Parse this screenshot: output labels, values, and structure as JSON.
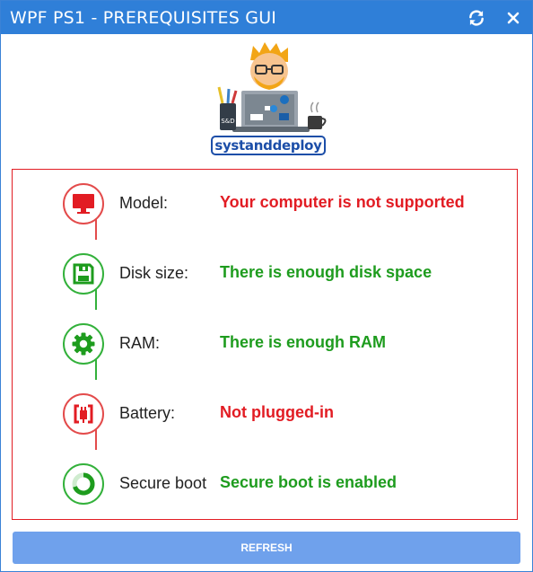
{
  "window": {
    "title": "WPF PS1 - PREREQUISITES GUI",
    "titlebar_color": "#2f7fd8"
  },
  "logo": {
    "text": "systanddeploy",
    "mug_text": "S&D"
  },
  "checks": [
    {
      "label": "Model:",
      "status": "Your computer is not supported",
      "state": "fail",
      "icon": "monitor-icon"
    },
    {
      "label": "Disk size:",
      "status": "There is enough disk space",
      "state": "ok",
      "icon": "floppy-disk-icon"
    },
    {
      "label": "RAM:",
      "status": "There is enough RAM",
      "state": "ok",
      "icon": "gear-icon"
    },
    {
      "label": "Battery:",
      "status": "Not plugged-in",
      "state": "fail",
      "icon": "plug-icon"
    },
    {
      "label": "Secure boot",
      "status": "Secure boot is enabled",
      "state": "ok",
      "icon": "spinner-icon"
    }
  ],
  "colors": {
    "fail": "#e21c23",
    "ok": "#1e9c1e",
    "panel_border": "#e21c23",
    "button": "#6fa1ec"
  },
  "footer": {
    "refresh_label": "REFRESH"
  }
}
